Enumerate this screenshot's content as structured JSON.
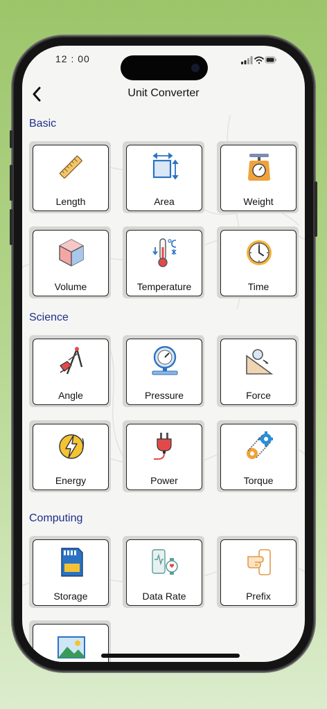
{
  "status": {
    "time": "12 : 00"
  },
  "header": {
    "title": "Unit Converter"
  },
  "sections": [
    {
      "title": "Basic",
      "items": [
        "Length",
        "Area",
        "Weight",
        "Volume",
        "Temperature",
        "Time"
      ]
    },
    {
      "title": "Science",
      "items": [
        "Angle",
        "Pressure",
        "Force",
        "Energy",
        "Power",
        "Torque"
      ]
    },
    {
      "title": "Computing",
      "items": [
        "Storage",
        "Data Rate",
        "Prefix"
      ]
    }
  ],
  "colors": {
    "section_title": "#1d2f8a",
    "background_top": "#9cc56a",
    "screen": "#f5f5f4"
  }
}
